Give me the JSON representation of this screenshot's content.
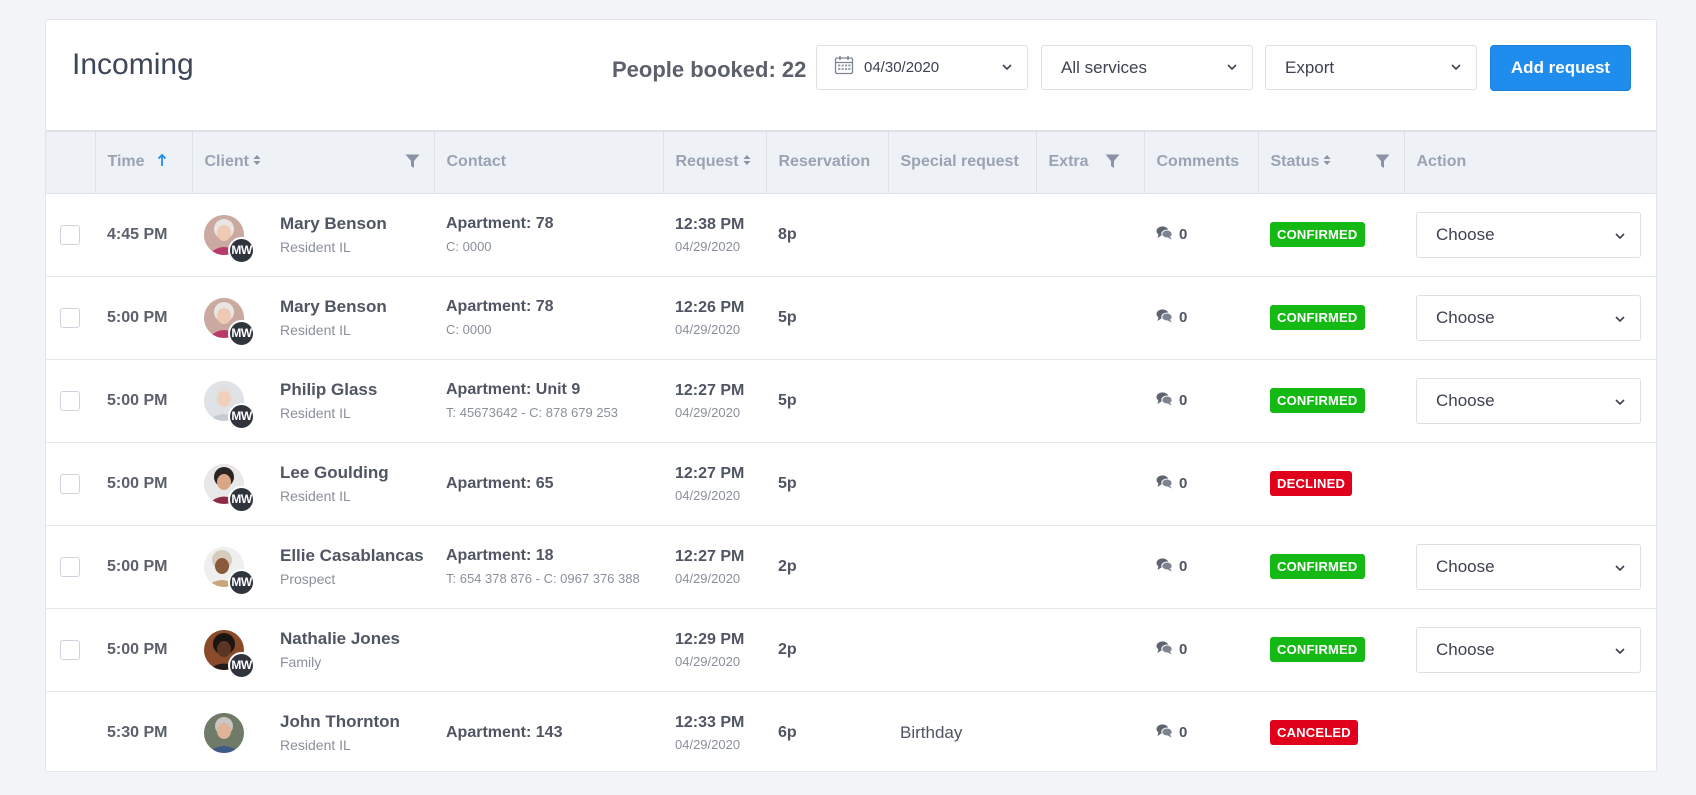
{
  "header": {
    "title": "Incoming",
    "people_booked": "People booked: 22",
    "date": "04/30/2020",
    "services": "All services",
    "export": "Export",
    "add_request": "Add request"
  },
  "columns": {
    "time": "Time",
    "client": "Client",
    "contact": "Contact",
    "request": "Request",
    "reservation": "Reservation",
    "special": "Special request",
    "extra": "Extra",
    "comments": "Comments",
    "status": "Status",
    "action": "Action"
  },
  "colors": {
    "accent": "#1f8ded",
    "confirmed": "#14b914",
    "declined": "#e0001b",
    "canceled": "#e0001b"
  },
  "rows": [
    {
      "time": "4:45 PM",
      "name": "Mary Benson",
      "role": "Resident IL",
      "badge": "MW",
      "contact": "Apartment: 78",
      "contact_sub": "C: 0000",
      "req_time": "12:38 PM",
      "req_date": "04/29/2020",
      "reservation": "8p",
      "special": "",
      "comments": "0",
      "status": "CONFIRMED",
      "status_color": "#14b914",
      "action": "Choose",
      "checkbox": true,
      "avatar": "woman-gray"
    },
    {
      "time": "5:00 PM",
      "name": "Mary Benson",
      "role": "Resident IL",
      "badge": "MW",
      "contact": "Apartment: 78",
      "contact_sub": "C: 0000",
      "req_time": "12:26 PM",
      "req_date": "04/29/2020",
      "reservation": "5p",
      "special": "",
      "comments": "0",
      "status": "CONFIRMED",
      "status_color": "#14b914",
      "action": "Choose",
      "checkbox": true,
      "avatar": "woman-gray"
    },
    {
      "time": "5:00 PM",
      "name": "Philip Glass",
      "role": "Resident IL",
      "badge": "MW",
      "contact": "Apartment: Unit 9",
      "contact_sub": "T: 45673642 - C: 878 679 253",
      "req_time": "12:27 PM",
      "req_date": "04/29/2020",
      "reservation": "5p",
      "special": "",
      "comments": "0",
      "status": "CONFIRMED",
      "status_color": "#14b914",
      "action": "Choose",
      "checkbox": true,
      "avatar": "man-light"
    },
    {
      "time": "5:00 PM",
      "name": "Lee Goulding",
      "role": "Resident IL",
      "badge": "MW",
      "contact": "Apartment: 65",
      "contact_sub": "",
      "req_time": "12:27 PM",
      "req_date": "04/29/2020",
      "reservation": "5p",
      "special": "",
      "comments": "0",
      "status": "DECLINED",
      "status_color": "#e0001b",
      "action": "",
      "checkbox": true,
      "avatar": "woman-dark"
    },
    {
      "time": "5:00 PM",
      "name": "Ellie Casablancas",
      "role": "Prospect",
      "badge": "MW",
      "contact": "Apartment: 18",
      "contact_sub": "T: 654 378 876 - C: 0967 376 388",
      "req_time": "12:27 PM",
      "req_date": "04/29/2020",
      "reservation": "2p",
      "special": "",
      "comments": "0",
      "status": "CONFIRMED",
      "status_color": "#14b914",
      "action": "Choose",
      "checkbox": true,
      "avatar": "woman-brown"
    },
    {
      "time": "5:00 PM",
      "name": "Nathalie Jones",
      "role": "Family",
      "badge": "MW",
      "contact": "",
      "contact_sub": "",
      "req_time": "12:29 PM",
      "req_date": "04/29/2020",
      "reservation": "2p",
      "special": "",
      "comments": "0",
      "status": "CONFIRMED",
      "status_color": "#14b914",
      "action": "Choose",
      "checkbox": true,
      "avatar": "woman-black"
    },
    {
      "time": "5:30 PM",
      "name": "John Thornton",
      "role": "Resident IL",
      "badge": "",
      "contact": "Apartment: 143",
      "contact_sub": "",
      "req_time": "12:33 PM",
      "req_date": "04/29/2020",
      "reservation": "6p",
      "special": "Birthday",
      "comments": "0",
      "status": "CANCELED",
      "status_color": "#e0001b",
      "action": "",
      "checkbox": false,
      "avatar": "man-gray"
    }
  ]
}
